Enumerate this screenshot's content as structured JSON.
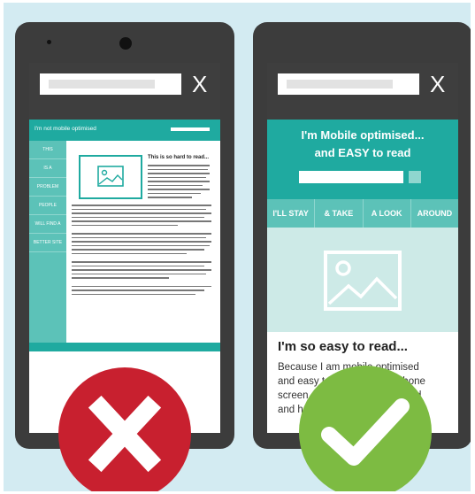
{
  "left_phone": {
    "banner_text": "I'm not mobile optimised",
    "nav_items": [
      "THIS",
      "IS A",
      "PROBLEM",
      "PEOPLE",
      "WILL FIND A",
      "BETTER SITE"
    ],
    "article_title": "This is so hard to read...",
    "close_symbol": "X"
  },
  "right_phone": {
    "header_line1": "I'm Mobile optimised...",
    "header_line2": "and EASY to read",
    "nav_items": [
      "I'LL STAY",
      "& TAKE",
      "A LOOK",
      "AROUND"
    ],
    "article_title": "I'm so easy to read...",
    "body_line1": "Because I am mobile optimised",
    "body_line2": "and easy to navigate on a phone",
    "body_line3": "screen, people will hang around",
    "body_line4": "and have a look",
    "close_symbol": "X"
  },
  "badges": {
    "bad_symbol": "✕",
    "good_symbol": "✓"
  },
  "colors": {
    "background": "#d3ebf2",
    "phone_body": "#3c3c3c",
    "teal": "#1faaa0",
    "light_teal": "#5cc2b8",
    "bad_red": "#c8202f",
    "good_green": "#7dbb42"
  },
  "icons": [
    "image-placeholder-icon",
    "close-icon",
    "cross-icon",
    "check-icon"
  ]
}
